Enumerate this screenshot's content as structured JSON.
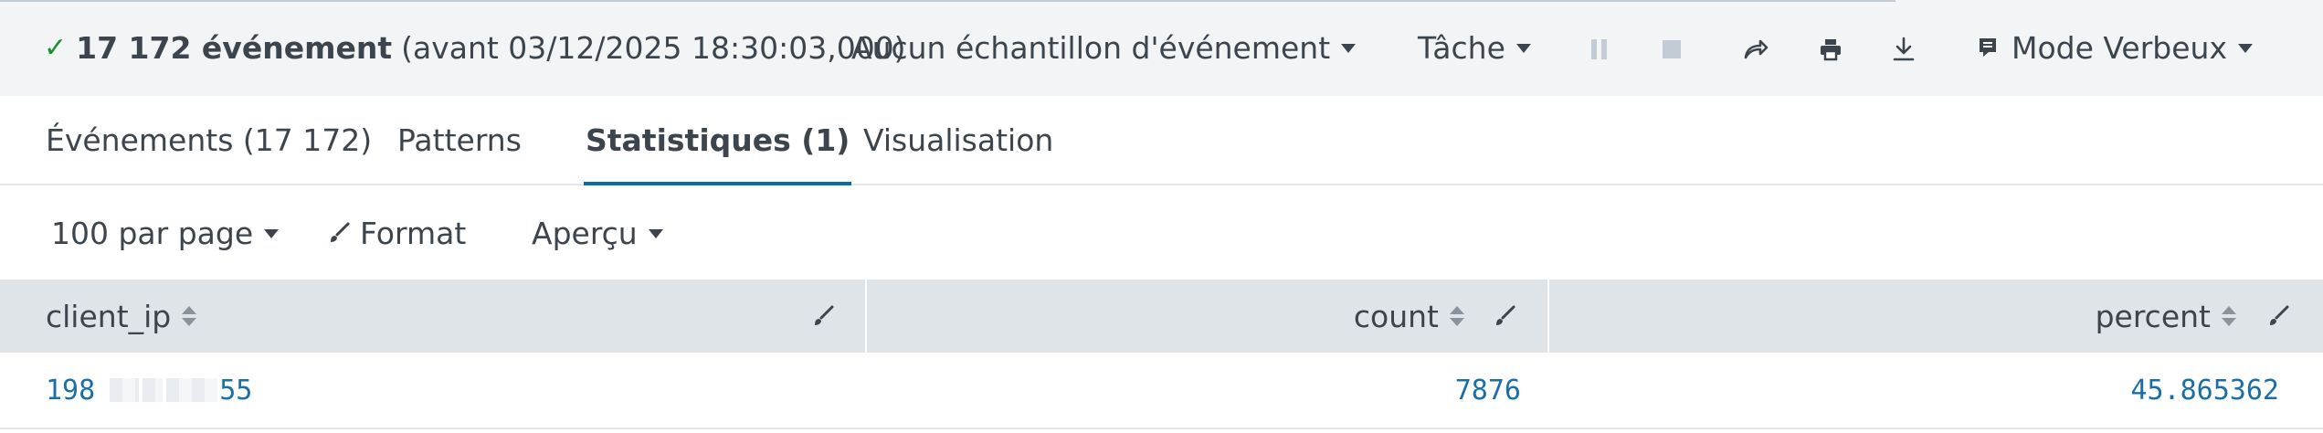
{
  "job": {
    "check": "✓",
    "event_count": "17 172 événement",
    "event_range": "(avant 03/12/2025 18:30:03,000)",
    "sampling": "Aucun échantillon d'événement",
    "task": "Tâche",
    "mode": "Mode Verbeux"
  },
  "tabs": [
    {
      "label": "Événements (17 172)",
      "active": false
    },
    {
      "label": "Patterns",
      "active": false
    },
    {
      "label": "Statistiques (1)",
      "active": true
    },
    {
      "label": "Visualisation",
      "active": false
    }
  ],
  "toolbar": {
    "per_page": "100 par page",
    "format": "Format",
    "preview": "Aperçu"
  },
  "table": {
    "columns": [
      "client_ip",
      "count",
      "percent"
    ],
    "rows": [
      {
        "client_ip_start": "198",
        "client_ip_end": "55",
        "count": "7876",
        "percent": "45.865362"
      }
    ]
  },
  "colors": {
    "accent": "#006eaa",
    "link": "#1a6fa8",
    "success": "#1a9035",
    "header_bg": "#dfe4e8",
    "bar_bg": "#f2f4f5"
  },
  "icons": [
    "check-icon",
    "caret-down-icon",
    "pause-icon",
    "stop-icon",
    "share-icon",
    "print-icon",
    "download-icon",
    "mode-icon",
    "brush-icon",
    "sort-icon",
    "edit-column-icon"
  ]
}
